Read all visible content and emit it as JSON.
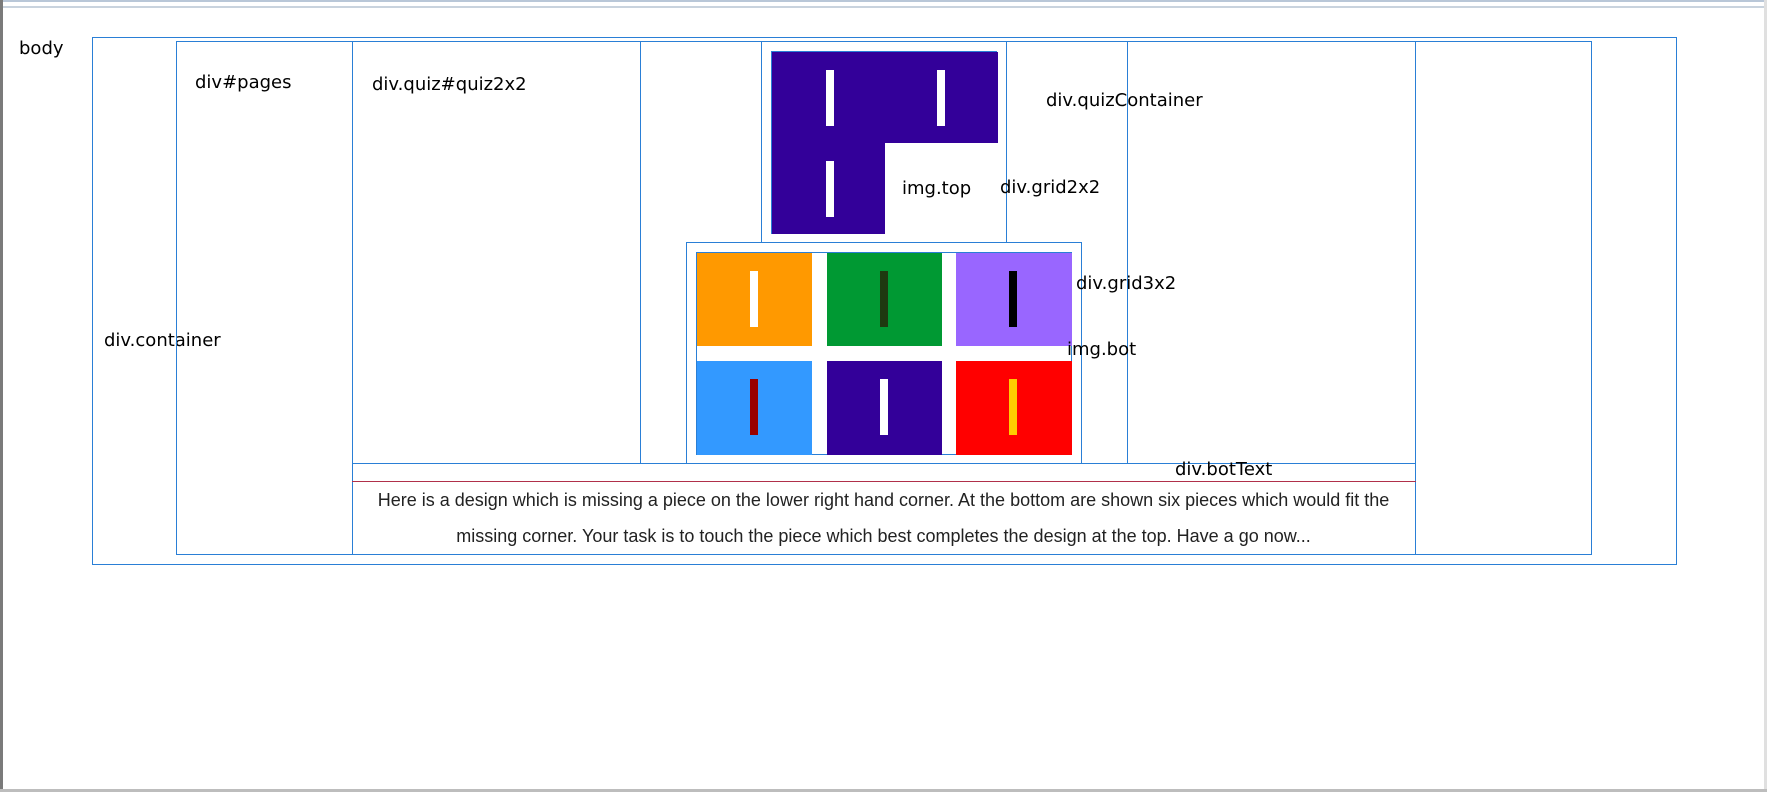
{
  "labels": {
    "body": "body",
    "container": "div.container",
    "pages": "div#pages",
    "quiz": "div.quiz#quiz2x2",
    "quizContainer": "div.quizContainer",
    "imgTop": "img.top",
    "grid2x2": "div.grid2x2",
    "grid3x2": "div.grid3x2",
    "imgBot": "img.bot",
    "botText": "div.botText"
  },
  "description": "Here is a design which is missing a piece on the lower right hand corner. At the bottom are shown six pieces which would fit the missing corner. Your task is to touch the piece which best completes the design at the top. Have a go now...",
  "colors": {
    "outline": "#2a7fd6",
    "divider": "#b0304a",
    "design": "#330099",
    "orange": "#ff9900",
    "green": "#009933",
    "purple": "#9966ff",
    "blue": "#3399ff",
    "red": "#ff0000"
  },
  "top_design": {
    "tiles": [
      {
        "color": "#330099",
        "bar": "#ffffff"
      },
      {
        "color": "#330099",
        "bar": "#ffffff"
      },
      {
        "color": "#330099",
        "bar": "#ffffff"
      },
      {
        "missing": true
      }
    ]
  },
  "answer_pieces": [
    {
      "name": "orange-piece",
      "color": "#ff9900",
      "bar": "#ffffff"
    },
    {
      "name": "green-piece",
      "color": "#009933",
      "bar": "#1e3a10"
    },
    {
      "name": "purple-piece",
      "color": "#9966ff",
      "bar": "#000000"
    },
    {
      "name": "blue-piece",
      "color": "#3399ff",
      "bar": "#990000"
    },
    {
      "name": "indigo-piece",
      "color": "#330099",
      "bar": "#ffffff"
    },
    {
      "name": "red-piece",
      "color": "#ff0000",
      "bar": "#ffcc00"
    }
  ]
}
